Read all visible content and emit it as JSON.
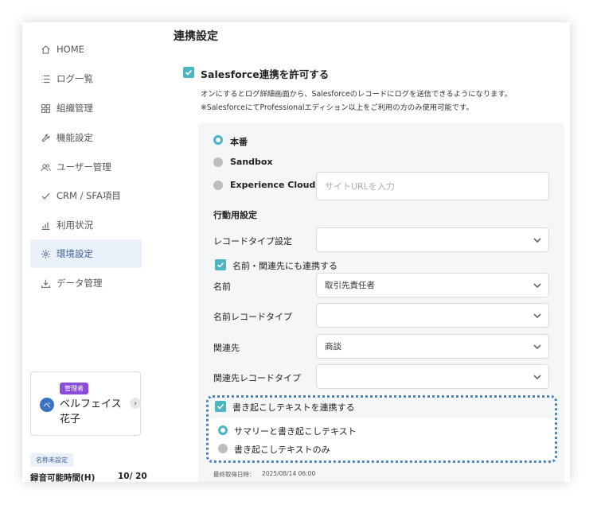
{
  "sidebar": {
    "items": [
      {
        "label": "HOME",
        "icon": "home-icon"
      },
      {
        "label": "ログ一覧",
        "icon": "list-icon"
      },
      {
        "label": "組織管理",
        "icon": "grid-icon"
      },
      {
        "label": "機能設定",
        "icon": "wrench-icon"
      },
      {
        "label": "ユーザー管理",
        "icon": "users-icon"
      },
      {
        "label": "CRM / SFA項目",
        "icon": "check-icon"
      },
      {
        "label": "利用状況",
        "icon": "bar-chart-icon"
      },
      {
        "label": "環境設定",
        "icon": "gear-icon",
        "active": true
      },
      {
        "label": "データ管理",
        "icon": "download-icon"
      }
    ],
    "user": {
      "role": "管理者",
      "avatar_initial": "ベ",
      "name": "ベルフェイス花子"
    },
    "name_unset_badge": "名称未設定",
    "recording": {
      "label": "録音可能時間(H)",
      "value": "10/ 20"
    }
  },
  "main": {
    "title": "連携設定",
    "salesforce": {
      "label": "Salesforce連携を許可する",
      "desc1": "オンにするとログ詳細画面から、Salesforceのレコードにログを送信できるようになります。",
      "desc2": "※SalesforceにてProfessionalエディション以上をご利用の方のみ使用可能です。"
    },
    "env": {
      "production": "本番",
      "sandbox": "Sandbox",
      "experience_cloud": "Experience Cloud",
      "url_placeholder": "サイトURLを入力"
    },
    "action_settings": {
      "title": "行動用設定",
      "record_type_label": "レコードタイプ設定",
      "record_type_value": "",
      "link_name_checkbox": "名前・関連先にも連携する",
      "name_label": "名前",
      "name_value": "取引先責任者",
      "name_record_type_label": "名前レコードタイプ",
      "name_record_type_value": "",
      "related_label": "関連先",
      "related_value": "商談",
      "related_record_type_label": "関連先レコードタイプ",
      "related_record_type_value": ""
    },
    "transcript": {
      "checkbox_label": "書き起こしテキストを連携する",
      "option_summary": "サマリーと書き起こしテキスト",
      "option_only": "書き起こしテキストのみ"
    },
    "meta": {
      "last_fetched_label": "最終取得日時：",
      "last_fetched_value": "2025/08/14 06:00"
    }
  },
  "colors": {
    "accent": "#4cb5c0",
    "active_nav_bg": "#eaf1fb",
    "badge_purple": "#8b4dd9",
    "dotted_border": "#3c86d6"
  }
}
